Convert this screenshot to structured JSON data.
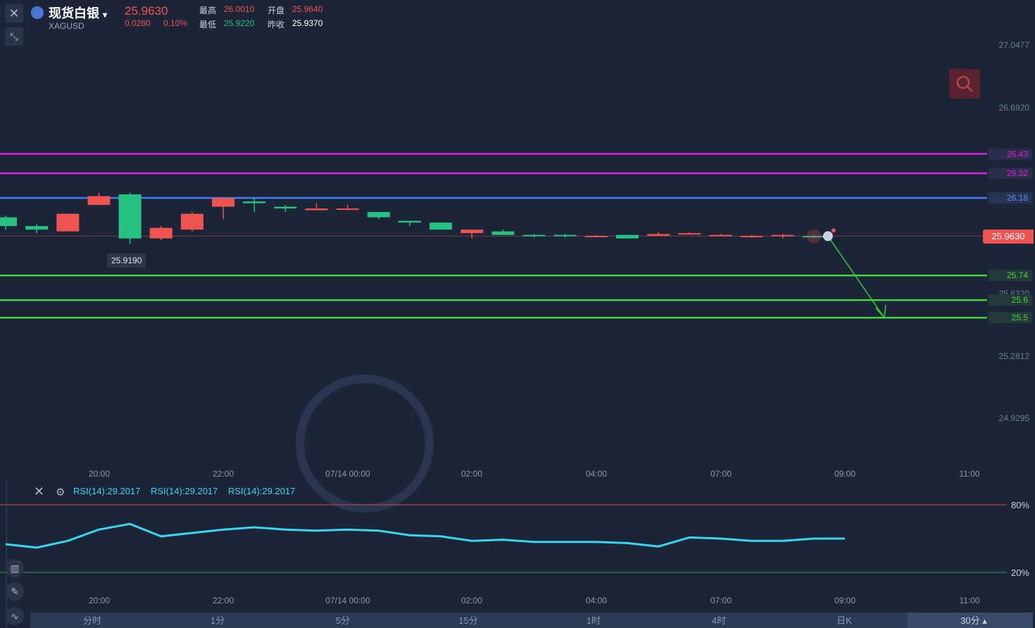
{
  "header": {
    "title": "现货白银",
    "symbol": "XAGUSD",
    "price": "25.9630",
    "change": "0.0260",
    "change_pct": "0.10%",
    "high_label": "最高",
    "high_value": "26.0010",
    "open_label": "开盘",
    "open_value": "25.9640",
    "low_label": "最低",
    "low_value": "25.9220",
    "prev_close_label": "昨收",
    "prev_close_value": "25.9370"
  },
  "colors": {
    "up": "#ef5350",
    "down": "#26c281",
    "resistance": "#e21ee6",
    "pivot": "#3d7bff",
    "support": "#45d13a",
    "rsi": "#38d7ef",
    "background": "#1c2538"
  },
  "icons": {
    "close": "close-icon",
    "collapse": "collapse-icon",
    "search": "search-icon",
    "info": "info-icon"
  },
  "y_axis_ticks": [
    "27.0477",
    "26.6920",
    "26.3320",
    "25.6320",
    "25.2812",
    "24.9295"
  ],
  "x_axis_ticks": [
    "20:00",
    "22:00",
    "07/14 00:00",
    "02:00",
    "04:00",
    "07:00",
    "09:00",
    "11:00"
  ],
  "current_price_tag": "25.9630",
  "low_tooltip": "25.9190",
  "level_lines": [
    {
      "label": "26.43",
      "type": "resistance"
    },
    {
      "label": "26.32",
      "type": "resistance"
    },
    {
      "label": "26.18",
      "type": "pivot"
    },
    {
      "label": "25.74",
      "type": "support"
    },
    {
      "label": "25.6",
      "type": "support"
    },
    {
      "label": "25.5",
      "type": "support"
    }
  ],
  "rsi": {
    "labels": [
      "RSI(14):29.2017",
      "RSI(14):29.2017",
      "RSI(14):29.2017"
    ],
    "upper_label": "80%",
    "lower_label": "20%",
    "x_axis_ticks": [
      "20:00",
      "22:00",
      "07/14 00:00",
      "02:00",
      "04:00",
      "07:00",
      "09:00",
      "11:00"
    ],
    "values": [
      45,
      42,
      48,
      58,
      63,
      52,
      55,
      58,
      60,
      58,
      57,
      58,
      57,
      53,
      52,
      48,
      49,
      47,
      47,
      47,
      46,
      43,
      51,
      50,
      48,
      48,
      50,
      50
    ]
  },
  "timeframes": [
    "分时",
    "1分",
    "5分",
    "15分",
    "1时",
    "4时",
    "日K",
    "30分"
  ],
  "active_timeframe": "30分",
  "chart_data": {
    "type": "candlestick",
    "title": "",
    "ylim": [
      24.75,
      27.2
    ],
    "candles": [
      {
        "o": 26.07,
        "c": 26.02,
        "h": 26.08,
        "l": 26.0
      },
      {
        "o": 26.02,
        "c": 26.0,
        "h": 26.03,
        "l": 25.98
      },
      {
        "o": 25.99,
        "c": 26.09,
        "h": 26.09,
        "l": 25.99
      },
      {
        "o": 26.14,
        "c": 26.19,
        "h": 26.21,
        "l": 26.14
      },
      {
        "o": 26.2,
        "c": 25.95,
        "h": 26.21,
        "l": 25.92
      },
      {
        "o": 25.95,
        "c": 26.01,
        "h": 26.02,
        "l": 25.94
      },
      {
        "o": 26.0,
        "c": 26.09,
        "h": 26.1,
        "l": 25.99
      },
      {
        "o": 26.13,
        "c": 26.18,
        "h": 26.18,
        "l": 26.06
      },
      {
        "o": 26.16,
        "c": 26.15,
        "h": 26.18,
        "l": 26.1
      },
      {
        "o": 26.13,
        "c": 26.12,
        "h": 26.14,
        "l": 26.1
      },
      {
        "o": 26.11,
        "c": 26.12,
        "h": 26.15,
        "l": 26.11
      },
      {
        "o": 26.12,
        "c": 26.12,
        "h": 26.14,
        "l": 26.11
      },
      {
        "o": 26.1,
        "c": 26.07,
        "h": 26.1,
        "l": 26.06
      },
      {
        "o": 26.05,
        "c": 26.04,
        "h": 26.05,
        "l": 26.02
      },
      {
        "o": 26.04,
        "c": 26.0,
        "h": 26.04,
        "l": 26.0
      },
      {
        "o": 25.98,
        "c": 26.0,
        "h": 26.0,
        "l": 25.95
      },
      {
        "o": 25.99,
        "c": 25.97,
        "h": 26.0,
        "l": 25.97
      },
      {
        "o": 25.97,
        "c": 25.965,
        "h": 25.975,
        "l": 25.955
      },
      {
        "o": 25.97,
        "c": 25.965,
        "h": 25.975,
        "l": 25.955
      },
      {
        "o": 25.965,
        "c": 25.965,
        "h": 25.97,
        "l": 25.96
      },
      {
        "o": 25.97,
        "c": 25.95,
        "h": 25.97,
        "l": 25.95
      },
      {
        "o": 25.965,
        "c": 25.975,
        "h": 25.985,
        "l": 25.965
      },
      {
        "o": 25.98,
        "c": 25.98,
        "h": 25.985,
        "l": 25.975
      },
      {
        "o": 25.97,
        "c": 25.97,
        "h": 25.975,
        "l": 25.965
      },
      {
        "o": 25.965,
        "c": 25.965,
        "h": 25.97,
        "l": 25.955
      },
      {
        "o": 25.965,
        "c": 25.97,
        "h": 25.975,
        "l": 25.95
      },
      {
        "o": 25.964,
        "c": 25.963,
        "h": 25.97,
        "l": 25.955
      }
    ],
    "levels": [
      26.43,
      26.32,
      26.18,
      25.74,
      25.6,
      25.5
    ],
    "forecast_target": 25.5
  }
}
